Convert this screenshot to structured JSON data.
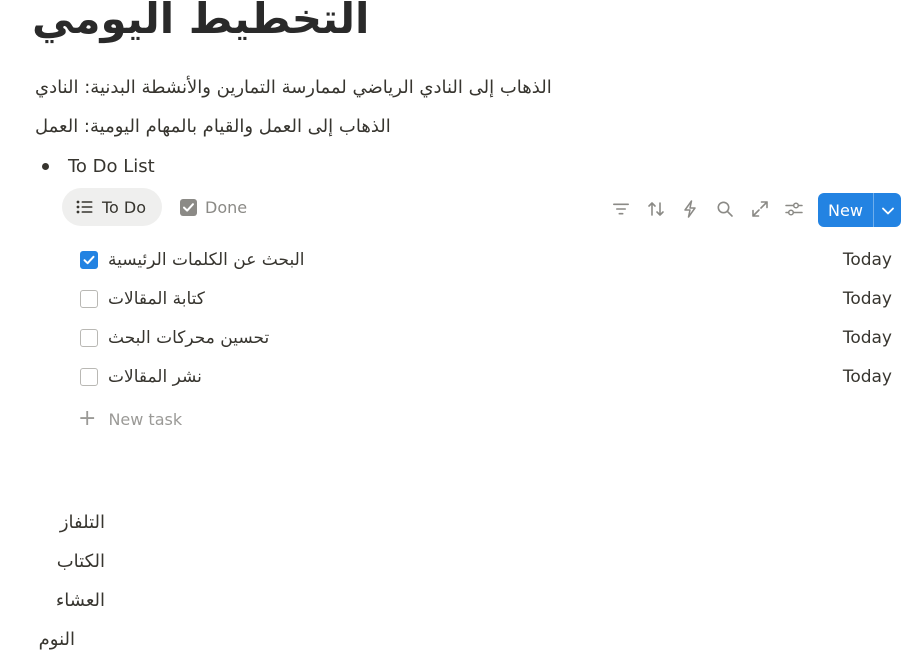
{
  "page": {
    "title": "التخطيط اليومي"
  },
  "paragraphs": [
    "الذهاب إلى النادي الرياضي لممارسة التمارين والأنشطة البدنية: النادي",
    "الذهاب إلى العمل والقيام بالمهام اليومية: العمل"
  ],
  "bullet": {
    "label": "To Do List"
  },
  "tabs": [
    {
      "label": "To Do",
      "icon": "list-icon",
      "active": true
    },
    {
      "label": "Done",
      "icon": "checkbox-checked-icon",
      "active": false
    }
  ],
  "toolbar": {
    "icons": [
      "filter-icon",
      "sort-icon",
      "lightning-icon",
      "search-icon",
      "expand-icon",
      "settings-sliders-icon"
    ],
    "new_label": "New"
  },
  "tasks": [
    {
      "title": "البحث عن الكلمات الرئيسية",
      "date": "Today",
      "done": true
    },
    {
      "title": "كتابة المقالات",
      "date": "Today",
      "done": false
    },
    {
      "title": "تحسين محركات البحث",
      "date": "Today",
      "done": false
    },
    {
      "title": "نشر المقالات",
      "date": "Today",
      "done": false
    }
  ],
  "new_task": {
    "label": "New task"
  },
  "bottom_items": [
    "التلفاز",
    "الكتاب",
    "العشاء",
    "النوم"
  ],
  "colors": {
    "accent": "#2383e2",
    "text": "#37352f",
    "muted": "#9b9a97",
    "active_tab_bg": "#efefee"
  }
}
